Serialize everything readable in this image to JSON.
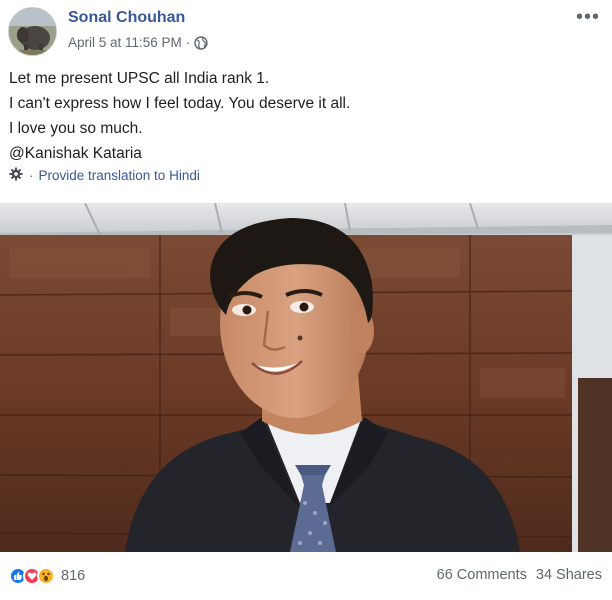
{
  "post": {
    "author_name": "Sonal Chouhan",
    "timestamp": "April 5 at 11:56 PM",
    "separator": "·",
    "privacy_icon": "globe-icon",
    "more_icon": "ellipsis-icon",
    "more_label": "•••",
    "text_lines": [
      "Let me present UPSC all India rank 1.",
      "I can't express how I feel today. You deserve it all.",
      "I love you so much.",
      "@Kanishak Kataria"
    ],
    "translation": {
      "icon": "gear-icon",
      "separator": "·",
      "label": "Provide translation to Hindi"
    }
  },
  "footer": {
    "reaction_icons": [
      "like-icon",
      "love-icon",
      "wow-icon"
    ],
    "reaction_count": "816",
    "comments": "66 Comments",
    "shares": "34 Shares"
  },
  "colors": {
    "link": "#385898",
    "meta": "#606770",
    "like": "#1877f2",
    "love": "#f33e58",
    "wow": "#f7b125"
  }
}
